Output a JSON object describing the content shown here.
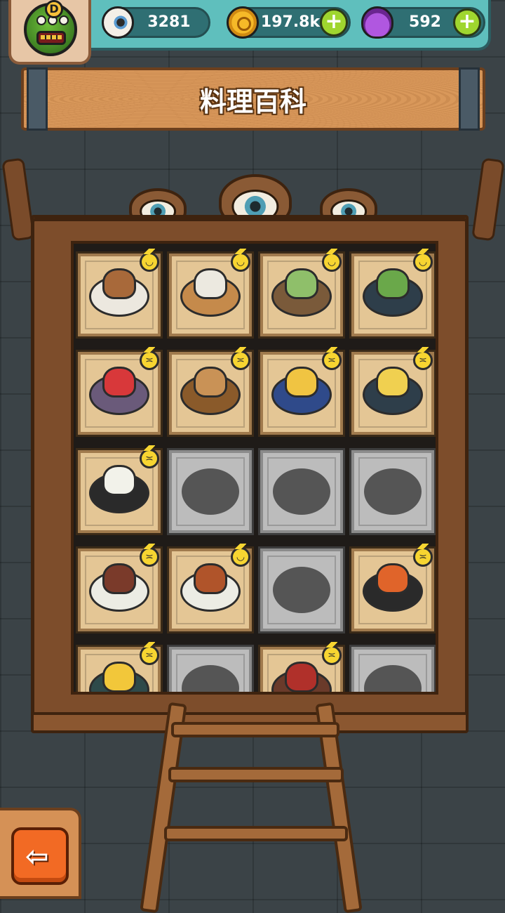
{
  "currency": {
    "eyeballs": "3281",
    "coins": "197.8k",
    "potions": "592"
  },
  "player": {
    "rank": "D"
  },
  "title": "料理百科",
  "colors": {
    "badge_yellow": "#f7d531",
    "locked_gray": "#bcbcbc",
    "unlocked_tan": "#e4c695",
    "back_orange": "#f26a24",
    "plus_green": "#9fd62f"
  },
  "recipes": [
    {
      "state": "unlocked",
      "icon": "egg-dish-icon",
      "plate": "#ece8df",
      "food": "#a8693a",
      "badge": "smile"
    },
    {
      "state": "unlocked",
      "icon": "rice-ball-icon",
      "plate": "#c58a4b",
      "food": "#ece9e0",
      "badge": "smile"
    },
    {
      "state": "unlocked",
      "icon": "green-vegetable-dish-icon",
      "plate": "#7a5a3a",
      "food": "#8fbf6a",
      "badge": "smile"
    },
    {
      "state": "unlocked",
      "icon": "lettuce-noodle-dish-icon",
      "plate": "#2e3e4a",
      "food": "#6aa84a",
      "badge": "smile"
    },
    {
      "state": "unlocked",
      "icon": "strawberry-rice-icon",
      "plate": "#6a5a7a",
      "food": "#d8383a",
      "badge": "grin"
    },
    {
      "state": "unlocked",
      "icon": "mushroom-stew-icon",
      "plate": "#8a5a2a",
      "food": "#c99256",
      "badge": "grin"
    },
    {
      "state": "unlocked",
      "icon": "cheese-bowl-icon",
      "plate": "#2f4a8a",
      "food": "#f0c442",
      "badge": "grin"
    },
    {
      "state": "unlocked",
      "icon": "tomato-egg-icon",
      "plate": "#2e3e4a",
      "food": "#f0d050",
      "badge": "grin"
    },
    {
      "state": "unlocked",
      "icon": "claypot-rice-icon",
      "plate": "#2a2a2a",
      "food": "#f2f2ea",
      "badge": "grin"
    },
    {
      "state": "locked",
      "icon": "locked-dish-silhouette-icon"
    },
    {
      "state": "locked",
      "icon": "locked-dish-silhouette-icon"
    },
    {
      "state": "locked",
      "icon": "locked-dish-silhouette-icon"
    },
    {
      "state": "unlocked",
      "icon": "sliced-meat-icon",
      "plate": "#ecece4",
      "food": "#7a3a2a",
      "badge": "grin"
    },
    {
      "state": "unlocked",
      "icon": "meatball-icon",
      "plate": "#ecece4",
      "food": "#b0542a",
      "badge": "smile"
    },
    {
      "state": "locked",
      "icon": "locked-dish-silhouette-icon"
    },
    {
      "state": "unlocked",
      "icon": "skewer-grill-icon",
      "plate": "#2a2a2a",
      "food": "#e0642a",
      "badge": "grin"
    },
    {
      "state": "unlocked",
      "icon": "corn-salad-icon",
      "plate": "#2e4a4a",
      "food": "#f2c73a",
      "badge": "grin"
    },
    {
      "state": "locked",
      "icon": "locked-dish-silhouette-icon"
    },
    {
      "state": "unlocked",
      "icon": "braised-meat-icon",
      "plate": "#6a3a2a",
      "food": "#b0302a",
      "badge": "grin"
    },
    {
      "state": "locked",
      "icon": "locked-dish-silhouette-icon"
    }
  ]
}
